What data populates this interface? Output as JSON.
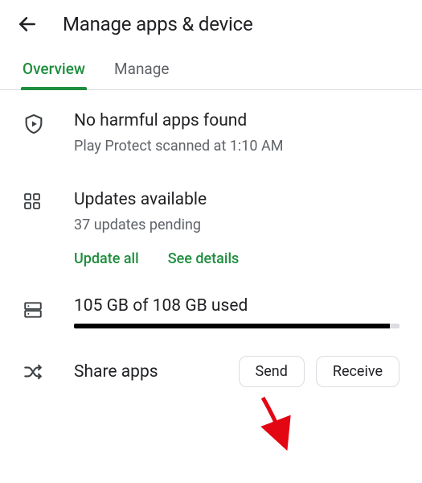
{
  "header": {
    "title": "Manage apps & device"
  },
  "tabs": [
    {
      "label": "Overview",
      "active": true
    },
    {
      "label": "Manage",
      "active": false
    }
  ],
  "protect": {
    "title": "No harmful apps found",
    "subtitle": "Play Protect scanned at 1:10 AM"
  },
  "updates": {
    "title": "Updates available",
    "subtitle": "37 updates pending",
    "update_all": "Update all",
    "see_details": "See details"
  },
  "storage": {
    "text": "105 GB of 108 GB used",
    "fill_percent": 97
  },
  "share": {
    "label": "Share apps",
    "send": "Send",
    "receive": "Receive"
  }
}
